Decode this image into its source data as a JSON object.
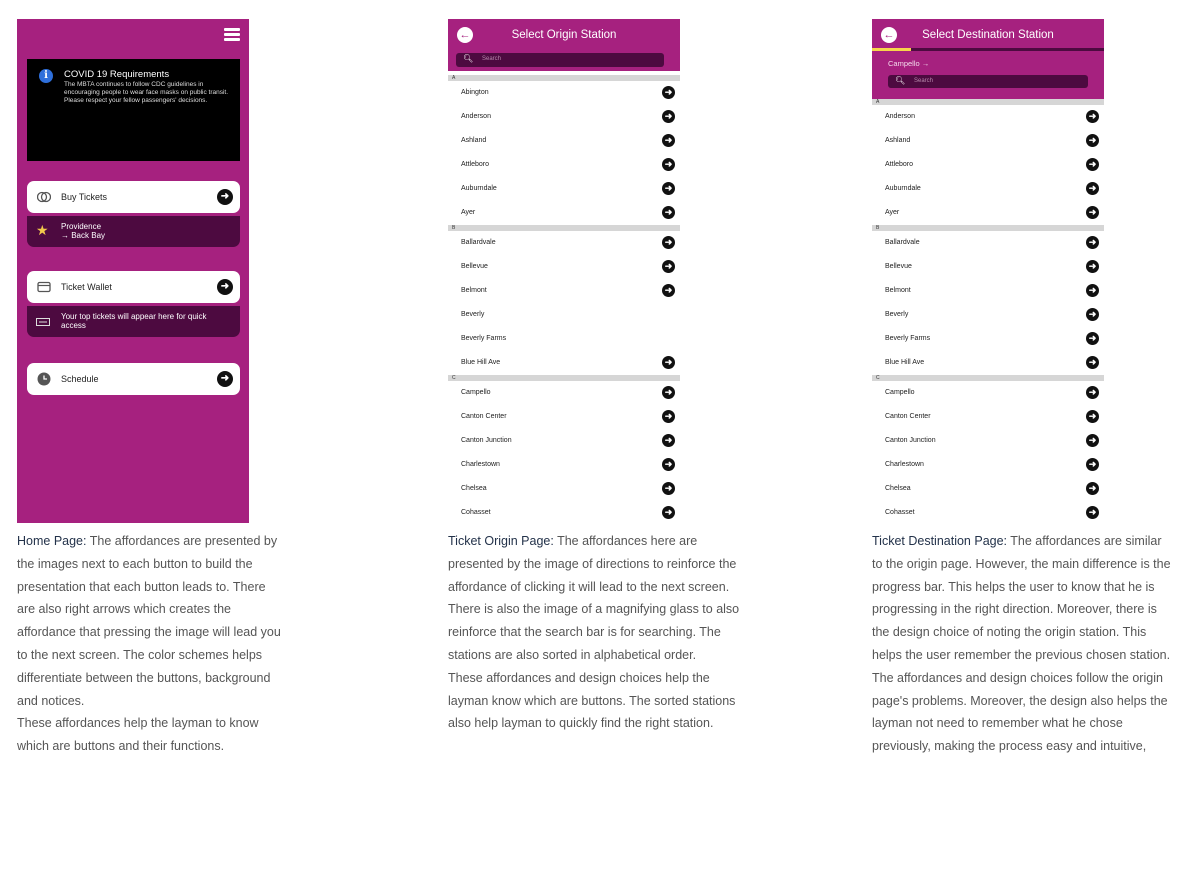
{
  "home": {
    "covid_title": "COVID 19 Requirements",
    "covid_body": "The MBTA continues to follow CDC guidelines in encouraging people to wear face masks on public transit. Please respect your fellow passengers' decisions.",
    "buy_tickets": "Buy Tickets",
    "favorite_line1": "Providence",
    "favorite_line2": "→ Back Bay",
    "ticket_wallet": "Ticket Wallet",
    "wallet_note": "Your top tickets will appear here for quick access",
    "schedule": "Schedule",
    "icons": [
      "menu-icon",
      "info-icon",
      "tickets-icon",
      "star-icon",
      "wallet-icon",
      "ticket-icon",
      "clock-icon",
      "arrow-right-icon"
    ]
  },
  "origin": {
    "title": "Select Origin Station",
    "search_placeholder": "Search",
    "sections": [
      {
        "letter": "A",
        "stations": [
          {
            "name": "Abington",
            "arrow": true
          },
          {
            "name": "Anderson",
            "arrow": true
          },
          {
            "name": "Ashland",
            "arrow": true
          },
          {
            "name": "Attleboro",
            "arrow": true
          },
          {
            "name": "Auburndale",
            "arrow": true
          },
          {
            "name": "Ayer",
            "arrow": true
          }
        ]
      },
      {
        "letter": "B",
        "stations": [
          {
            "name": "Ballardvale",
            "arrow": true
          },
          {
            "name": "Bellevue",
            "arrow": true
          },
          {
            "name": "Belmont",
            "arrow": true
          },
          {
            "name": "Beverly",
            "arrow": false
          },
          {
            "name": "Beverly Farms",
            "arrow": false
          },
          {
            "name": "Blue Hill Ave",
            "arrow": true
          }
        ]
      },
      {
        "letter": "C",
        "stations": [
          {
            "name": "Campello",
            "arrow": true
          },
          {
            "name": "Canton Center",
            "arrow": true
          },
          {
            "name": "Canton Junction",
            "arrow": true
          },
          {
            "name": "Charlestown",
            "arrow": true
          },
          {
            "name": "Chelsea",
            "arrow": true
          },
          {
            "name": "Cohasset",
            "arrow": true
          }
        ]
      }
    ]
  },
  "destination": {
    "title": "Select Destination Station",
    "origin_crumb": "Campello →",
    "search_placeholder": "Search",
    "progress_fraction": 0.17,
    "sections": [
      {
        "letter": "A",
        "stations": [
          {
            "name": "Anderson",
            "arrow": true
          },
          {
            "name": "Ashland",
            "arrow": true
          },
          {
            "name": "Attleboro",
            "arrow": true
          },
          {
            "name": "Auburndale",
            "arrow": true
          },
          {
            "name": "Ayer",
            "arrow": true
          }
        ]
      },
      {
        "letter": "B",
        "stations": [
          {
            "name": "Ballardvale",
            "arrow": true
          },
          {
            "name": "Bellevue",
            "arrow": true
          },
          {
            "name": "Belmont",
            "arrow": true
          },
          {
            "name": "Beverly",
            "arrow": true
          },
          {
            "name": "Beverly Farms",
            "arrow": true
          },
          {
            "name": "Blue Hill Ave",
            "arrow": true
          }
        ]
      },
      {
        "letter": "C",
        "stations": [
          {
            "name": "Campello",
            "arrow": true
          },
          {
            "name": "Canton Center",
            "arrow": true
          },
          {
            "name": "Canton Junction",
            "arrow": true
          },
          {
            "name": "Charlestown",
            "arrow": true
          },
          {
            "name": "Chelsea",
            "arrow": true
          },
          {
            "name": "Cohasset",
            "arrow": true
          }
        ]
      }
    ]
  },
  "captions": {
    "home_lead": "Home Page:",
    "home_text": " The affordances are presented by the images next to each button to build the presentation that each button leads to. There are also right arrows which creates the affordance that pressing the image will lead you to the next screen. The color schemes helps differentiate between the buttons, background and notices.",
    "home_text2": "These affordances help the layman to know which are buttons and their functions.",
    "origin_lead": "Ticket Origin Page:",
    "origin_text": " The affordances here are presented by the image of directions to reinforce the affordance of clicking it will lead to the next screen. There is also the image of a magnifying glass to also reinforce that the search bar is for searching. The stations are also sorted in alphabetical order.",
    "origin_text2": "These affordances and design choices help the layman know which are buttons. The sorted stations also help layman to quickly find the right station.",
    "dest_lead": "Ticket Destination Page:",
    "dest_text": " The affordances are similar to the origin page. However, the main difference is the progress bar. This helps the user to know that he is progressing in the right direction. Moreover, there is the design choice of noting the origin station. This helps the user remember the previous chosen station.",
    "dest_text2": "The affordances and design choices follow the origin page's problems. Moreover, the design also helps the layman not need to remember what he chose previously, making the process easy and intuitive,"
  },
  "colors": {
    "brand": "#a6217f",
    "dark": "#4d0a40",
    "progress": "#f7d54b"
  }
}
